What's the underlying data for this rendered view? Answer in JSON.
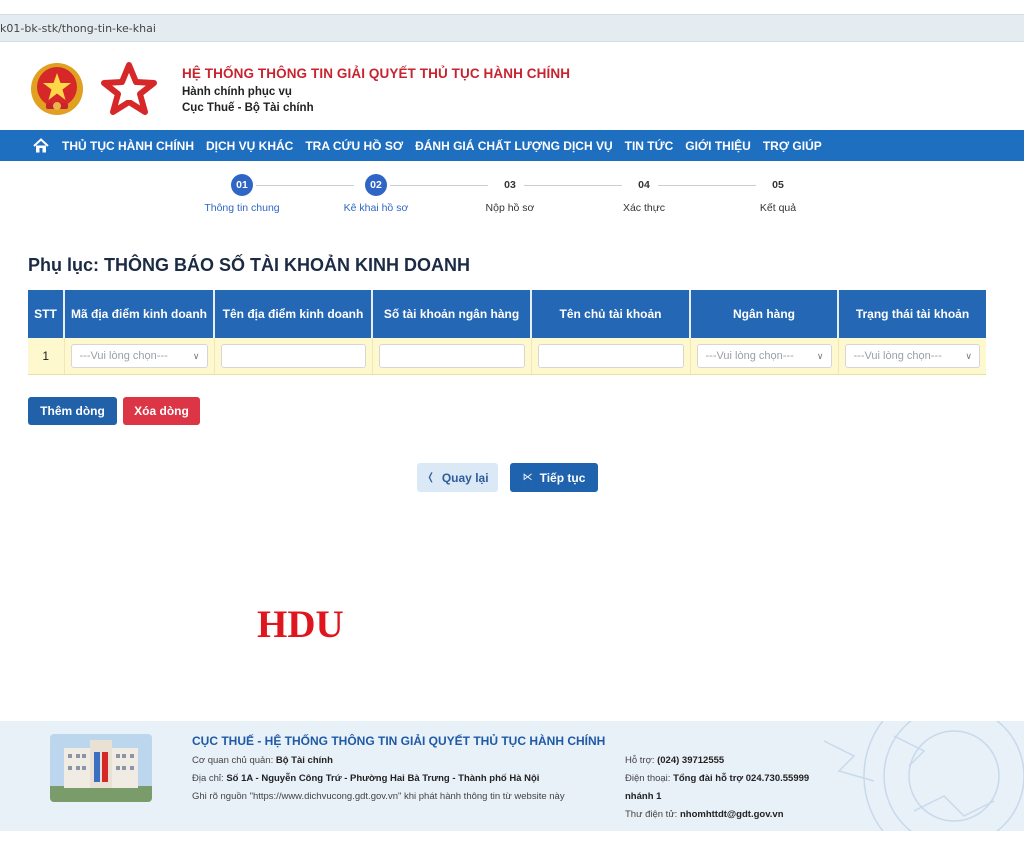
{
  "browser": {
    "url": "k01-bk-stk/thong-tin-ke-khai"
  },
  "header": {
    "title": "HỆ THỐNG THÔNG TIN GIẢI QUYẾT THỦ TỤC HÀNH CHÍNH",
    "subtitle1": "Hành chính phục vụ",
    "subtitle2": "Cục Thuế - Bộ Tài chính"
  },
  "nav": {
    "items": [
      "THỦ TỤC HÀNH CHÍNH",
      "DỊCH VỤ KHÁC",
      "TRA CỨU HỒ SƠ",
      "ĐÁNH GIÁ CHẤT LƯỢNG DỊCH VỤ",
      "TIN TỨC",
      "GIỚI THIỆU",
      "TRỢ GIÚP"
    ]
  },
  "stepper": {
    "steps": [
      {
        "num": "01",
        "label": "Thông tin chung"
      },
      {
        "num": "02",
        "label": "Kê khai hồ sơ"
      },
      {
        "num": "03",
        "label": "Nộp hồ sơ"
      },
      {
        "num": "04",
        "label": "Xác thực"
      },
      {
        "num": "05",
        "label": "Kết quả"
      }
    ],
    "active_steps": 2
  },
  "page": {
    "title": "Phụ lục: THÔNG BÁO SỐ TÀI KHOẢN KINH DOANH"
  },
  "table": {
    "headers": [
      "STT",
      "Mã địa điểm kinh doanh",
      "Tên địa điểm kinh doanh",
      "Số tài khoản ngân hàng",
      "Tên chủ tài khoản",
      "Ngân hàng",
      "Trạng thái tài khoản"
    ],
    "rows": [
      {
        "stt": "1",
        "ma_dia_diem": "---Vui lòng chọn---",
        "ten_dia_diem": "",
        "so_tai_khoan": "",
        "ten_chu_tk": "",
        "ngan_hang": "---Vui lòng chọn---",
        "trang_thai": "---Vui lòng chọn---"
      }
    ]
  },
  "buttons": {
    "add_row": "Thêm dòng",
    "delete_row": "Xóa dòng",
    "back": "Quay lại",
    "next": "Tiếp tục"
  },
  "watermark": "HDU",
  "footer": {
    "title": "CỤC THUẾ - HỆ THỐNG THÔNG TIN GIẢI QUYẾT THỦ TỤC HÀNH CHÍNH",
    "agency_label": "Cơ quan chủ quản:",
    "agency": "Bộ Tài chính",
    "address_label": "Địa chỉ:",
    "address": "Số 1A - Nguyễn Công Trứ - Phường Hai Bà Trưng - Thành phố Hà Nội",
    "source_note": "Ghi rõ nguồn \"https://www.dichvucong.gdt.gov.vn\" khi phát hành thông tin từ website này",
    "support_label": "Hỗ trợ:",
    "support": "(024) 39712555",
    "phone_label": "Điện thoại:",
    "phone": "Tổng đài hỗ trợ 024.730.55999",
    "phone_ext": "nhánh 1",
    "email_label": "Thư điện tử:",
    "email": "nhomhttdt@gdt.gov.vn"
  },
  "colors": {
    "nav": "#1f6fc0",
    "table_header": "#2467b4",
    "row_bg": "#fdf8cd",
    "delete": "#dc3545",
    "title_red": "#c8242f",
    "active_step": "#2f66c6"
  }
}
